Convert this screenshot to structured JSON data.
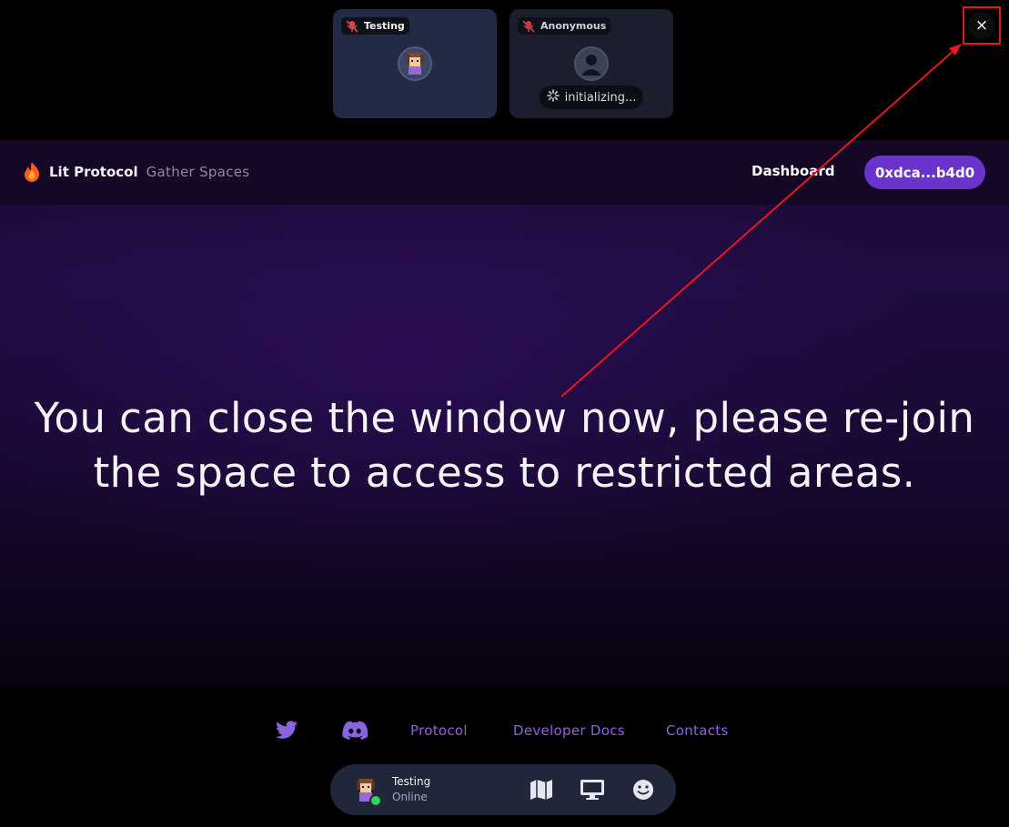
{
  "call": {
    "participants": [
      {
        "name": "Testing",
        "mic": "muted",
        "avatar": "pixel-avatar"
      },
      {
        "name": "Anonymous",
        "mic": "muted",
        "avatar": "default-user-icon",
        "status": "initializing..."
      }
    ],
    "close_label": "×"
  },
  "navbar": {
    "brand_name": "Lit Protocol",
    "brand_sub": "Gather Spaces",
    "dashboard_label": "Dashboard",
    "wallet_label": "0xdca...b4d0"
  },
  "main": {
    "headline_line1": "You can close the window now, please re-join",
    "headline_line2": "the space to access to restricted areas."
  },
  "footer": {
    "links": [
      "Protocol",
      "Developer Docs",
      "Contacts"
    ],
    "icons": [
      "twitter-icon",
      "discord-icon"
    ]
  },
  "bottom_bar": {
    "user_name": "Testing",
    "user_status": "Online",
    "actions": [
      "map-icon",
      "screen-share-icon",
      "emoji-icon"
    ]
  },
  "colors": {
    "accent": "#6a33cc",
    "link": "#8a63e2",
    "annotation": "#e8161c",
    "online": "#35d15e"
  }
}
